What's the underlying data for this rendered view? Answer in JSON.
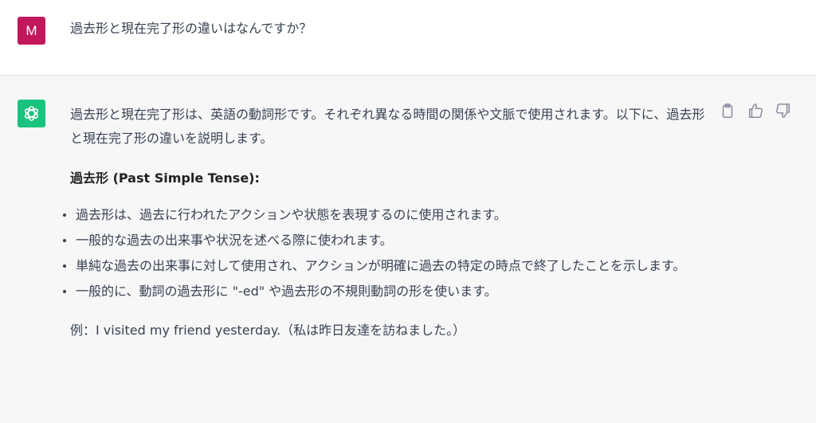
{
  "user_message": {
    "avatar_letter": "M",
    "text": "過去形と現在完了形の違いはなんですか？"
  },
  "assistant_message": {
    "intro": "過去形と現在完了形は、英語の動詞形です。それぞれ異なる時間の関係や文脈で使用されます。以下に、過去形と現在完了形の違いを説明します。",
    "section_heading": "過去形 (Past Simple Tense):",
    "bullets": [
      "過去形は、過去に行われたアクションや状態を表現するのに使用されます。",
      "一般的な過去の出来事や状況を述べる際に使われます。",
      "単純な過去の出来事に対して使用され、アクションが明確に過去の特定の時点で終了したことを示します。",
      "一般的に、動詞の過去形に \"-ed\" や過去形の不規則動詞の形を使います。"
    ],
    "example": "例：I visited my friend yesterday.（私は昨日友達を訪ねました。）"
  },
  "actions": {
    "copy_icon": "clipboard-icon",
    "like_icon": "thumbs-up-icon",
    "dislike_icon": "thumbs-down-icon"
  },
  "colors": {
    "user_avatar": "#c2185b",
    "assistant_avatar": "#19c37d",
    "assistant_bg": "#f7f7f8"
  }
}
